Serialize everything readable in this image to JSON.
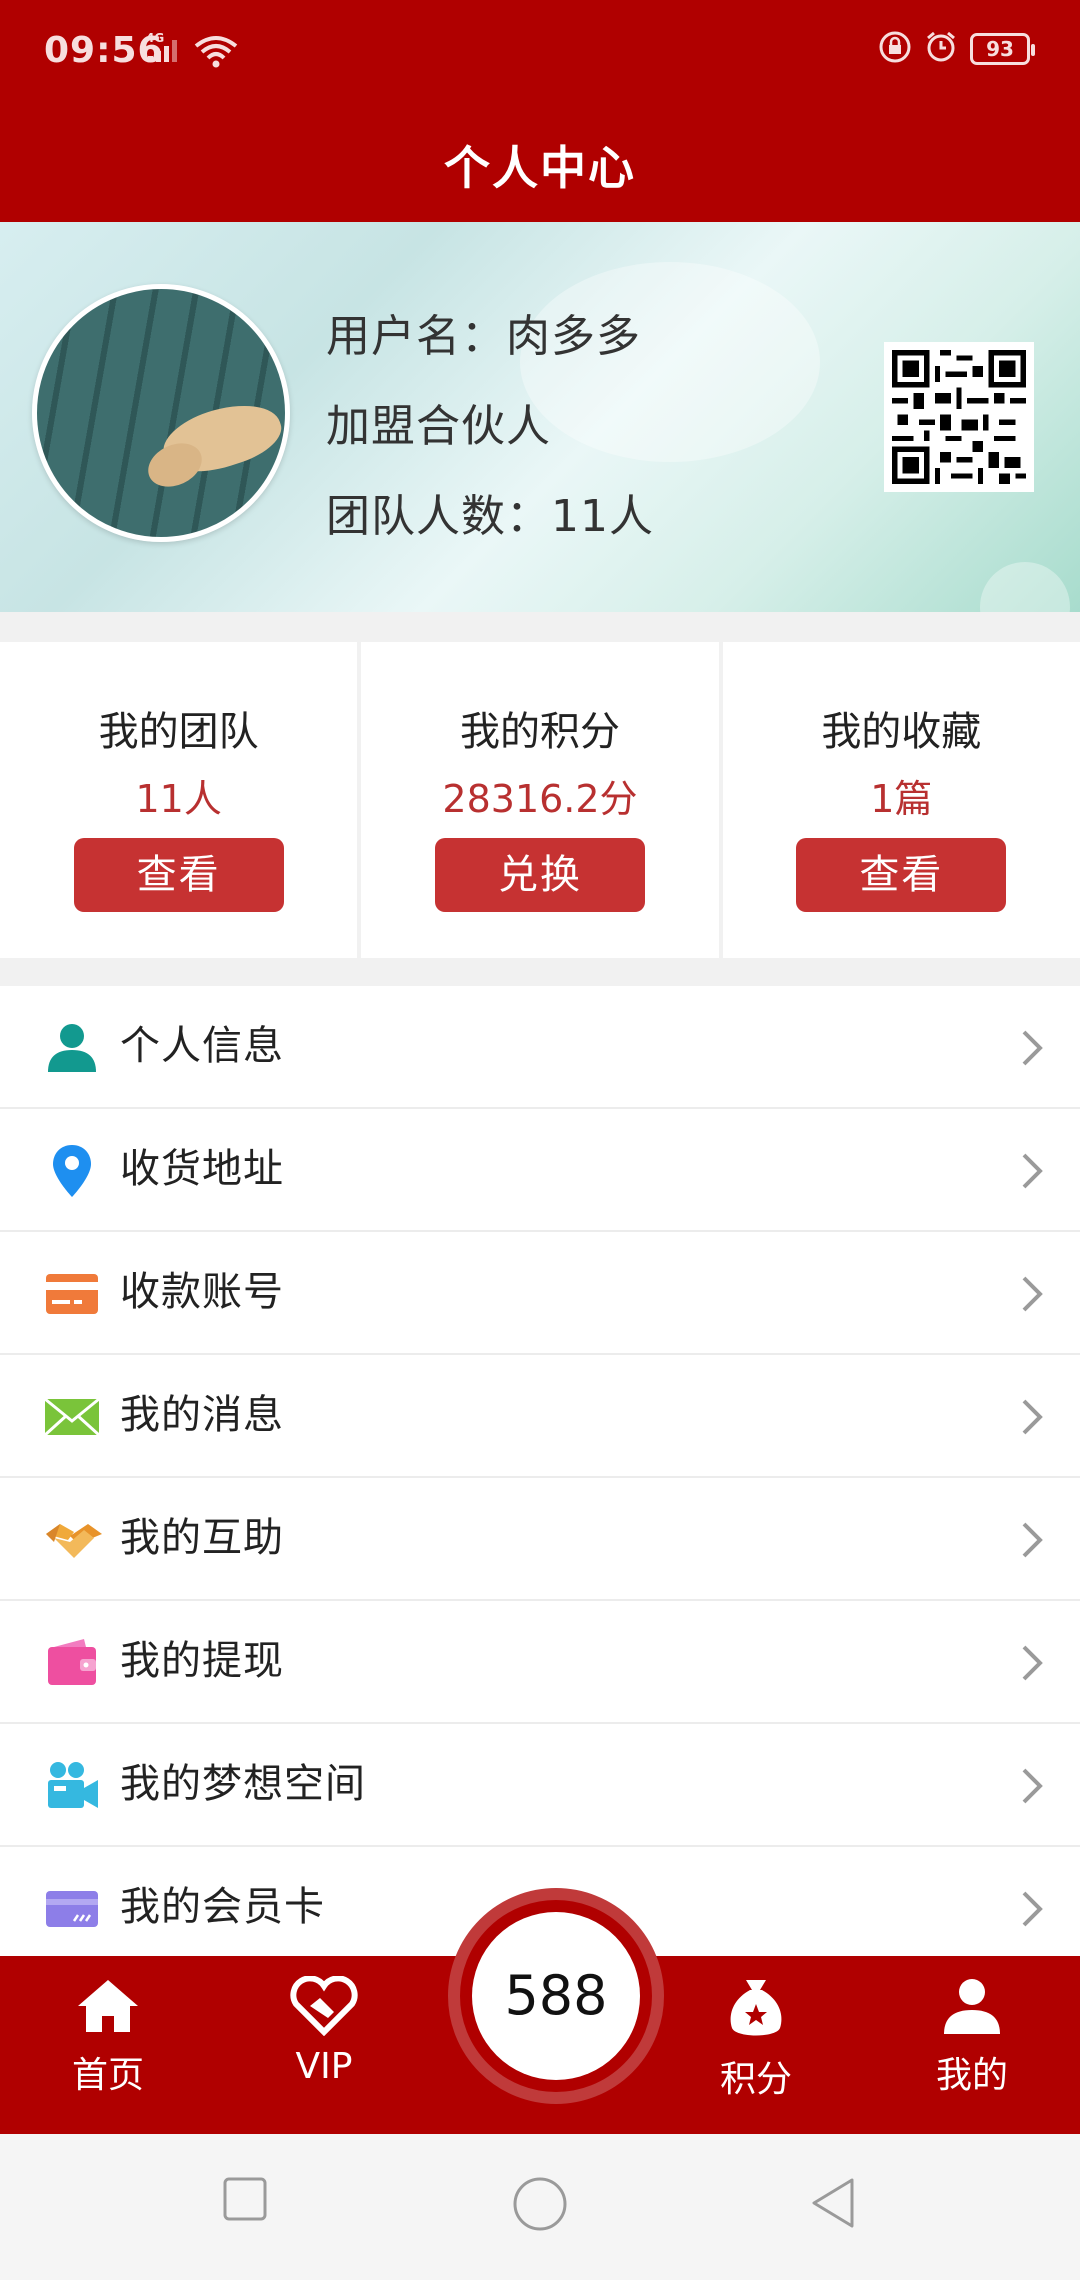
{
  "status_bar": {
    "time": "09:56",
    "network": "4G",
    "battery": "93"
  },
  "header": {
    "title": "个人中心"
  },
  "profile": {
    "username_line": "用户名：肉多多",
    "role": "加盟合伙人",
    "team_count_line": "团队人数：11人"
  },
  "stats": [
    {
      "title": "我的团队",
      "value": "11人",
      "button": "查看"
    },
    {
      "title": "我的积分",
      "value": "28316.2分",
      "button": "兑换"
    },
    {
      "title": "我的收藏",
      "value": "1篇",
      "button": "查看"
    }
  ],
  "menu": [
    {
      "label": "个人信息",
      "icon": "person-icon",
      "color": "#12998f"
    },
    {
      "label": "收货地址",
      "icon": "location-pin-icon",
      "color": "#1e8ff0"
    },
    {
      "label": "收款账号",
      "icon": "card-icon",
      "color": "#f07a3a"
    },
    {
      "label": "我的消息",
      "icon": "envelope-icon",
      "color": "#7ac43a"
    },
    {
      "label": "我的互助",
      "icon": "handshake-icon",
      "color": "#f0a93a"
    },
    {
      "label": "我的提现",
      "icon": "wallet-icon",
      "color": "#ee4fa0"
    },
    {
      "label": "我的梦想空间",
      "icon": "video-camera-icon",
      "color": "#35b8e0"
    },
    {
      "label": "我的会员卡",
      "icon": "member-card-icon",
      "color": "#8d7ee8"
    }
  ],
  "bottom_nav": {
    "home": "首页",
    "vip": "VIP",
    "center_value": "588",
    "points": "积分",
    "me": "我的"
  },
  "colors": {
    "brand_red": "#b00000",
    "button_red": "#c63232",
    "value_red": "#b83030"
  }
}
